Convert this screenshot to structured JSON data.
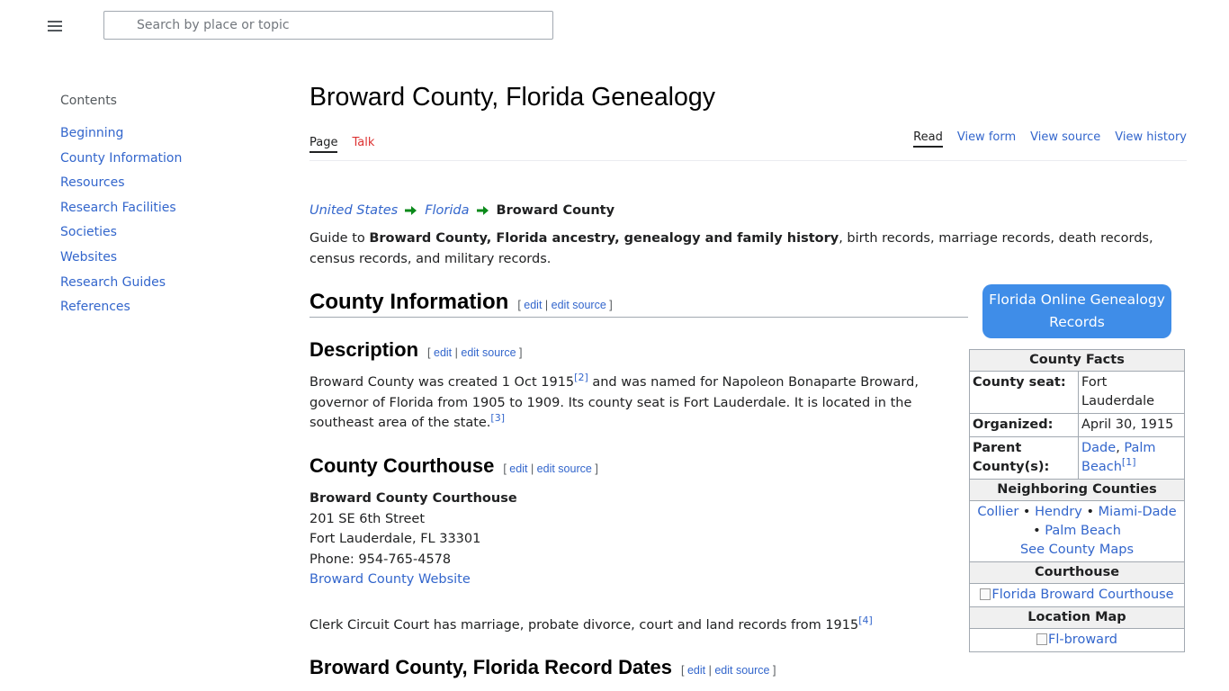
{
  "header": {
    "search_placeholder": "Search by place or topic"
  },
  "toc": {
    "title": "Contents",
    "items": [
      "Beginning",
      "County Information",
      "Resources",
      "Research Facilities",
      "Societies",
      "Websites",
      "Research Guides",
      "References"
    ]
  },
  "page": {
    "title": "Broward County, Florida Genealogy",
    "tabs_left": [
      {
        "label": "Page",
        "active": true
      },
      {
        "label": "Talk",
        "active": false
      }
    ],
    "tabs_right": [
      {
        "label": "Read",
        "active": true
      },
      {
        "label": "View form"
      },
      {
        "label": "View source"
      },
      {
        "label": "View history"
      }
    ]
  },
  "breadcrumb": {
    "items": [
      "United States",
      "Florida"
    ],
    "current": "Broward County"
  },
  "intro": {
    "prefix": "Guide to ",
    "bold": "Broward County, Florida ancestry, genealogy and family history",
    "suffix": ", birth records, marriage records, death records, census records, and military records."
  },
  "edit": {
    "open": "[",
    "edit": "edit",
    "sep": "|",
    "edit_source": "edit source",
    "close": "]"
  },
  "sections": {
    "county_info": "County Information",
    "description": "Description",
    "courthouse": "County Courthouse",
    "record_dates": "Broward County, Florida Record Dates"
  },
  "description": {
    "part1": "Broward County was created 1 Oct 1915",
    "ref1": "[2]",
    "part2": " and was named for Napoleon Bonaparte Broward, governor of Florida from 1905 to 1909. Its county seat is Fort Lauderdale. It is located in the southeast area of the state.",
    "ref2": "[3]"
  },
  "courthouse": {
    "name": "Broward County Courthouse",
    "street": "201 SE 6th Street",
    "city": "Fort Lauderdale, FL 33301",
    "phone": "Phone: 954-765-4578",
    "website": "Broward County Website"
  },
  "clerk": {
    "text": "Clerk Circuit Court has marriage, probate divorce, court and land records from 1915",
    "ref": "[4]"
  },
  "cta": {
    "label": "Florida Online Genealogy Records"
  },
  "facts": {
    "title": "County Facts",
    "seat_label": "County seat:",
    "seat_value": "Fort Lauderdale",
    "organized_label": "Organized:",
    "organized_value": "April 30, 1915",
    "parent_label": "Parent County(s):",
    "parent_values": [
      "Dade",
      "Palm Beach"
    ],
    "parent_ref": "[1]",
    "neighbor_title": "Neighboring Counties",
    "neighbors": [
      "Collier",
      "Hendry",
      "Miami-Dade",
      "Palm Beach"
    ],
    "bullet": "•",
    "maps_link": "See County Maps",
    "courthouse_title": "Courthouse",
    "courthouse_img_alt": "Florida Broward Courthouse",
    "map_title": "Location Map",
    "map_img_alt": "Fl-broward"
  },
  "colors": {
    "link": "#3366cc",
    "cta_bg": "#3f8de8",
    "arrow": "#0a8a1a",
    "talk": "#dd3333"
  }
}
